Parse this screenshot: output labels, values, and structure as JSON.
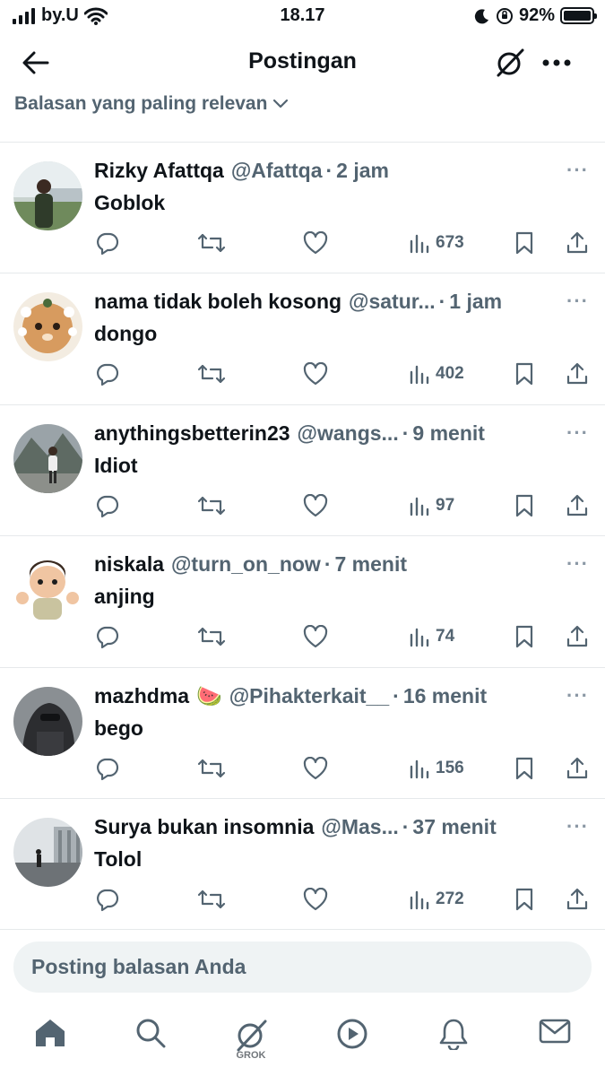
{
  "status_bar": {
    "carrier": "by.U",
    "time": "18.17",
    "battery": "92%"
  },
  "header": {
    "title": "Postingan"
  },
  "sort_label": "Balasan yang paling relevan",
  "replies": [
    {
      "name": "Rizky Afattqa",
      "emoji": "",
      "handle": "@Afattqa",
      "time": "2 jam",
      "text": "Goblok",
      "views": "673"
    },
    {
      "name": "nama tidak boleh kosong",
      "emoji": "",
      "handle": "@satur...",
      "time": "1 jam",
      "text": "dongo",
      "views": "402"
    },
    {
      "name": "anythingsbetterin23",
      "emoji": "",
      "handle": "@wangs...",
      "time": "9 menit",
      "text": "Idiot",
      "views": "97"
    },
    {
      "name": "niskala",
      "emoji": "",
      "handle": "@turn_on_now",
      "time": "7 menit",
      "text": "anjing",
      "views": "74"
    },
    {
      "name": "mazhdma",
      "emoji": "🍉",
      "handle": "@Pihakterkait__",
      "time": "16 menit",
      "text": "bego",
      "views": "156"
    },
    {
      "name": "Surya bukan insomnia",
      "emoji": "",
      "handle": "@Mas...",
      "time": "37 menit",
      "text": "Tolol",
      "views": "272"
    }
  ],
  "separator": "·",
  "more_dots": "···",
  "composer": {
    "placeholder": "Posting balasan Anda"
  },
  "bottom_nav": {
    "grok_label": "GROK"
  },
  "colors": {
    "text": "#0f1419",
    "secondary": "#536471",
    "divider": "#e6e9eb",
    "composer_bg": "#eff3f4"
  }
}
